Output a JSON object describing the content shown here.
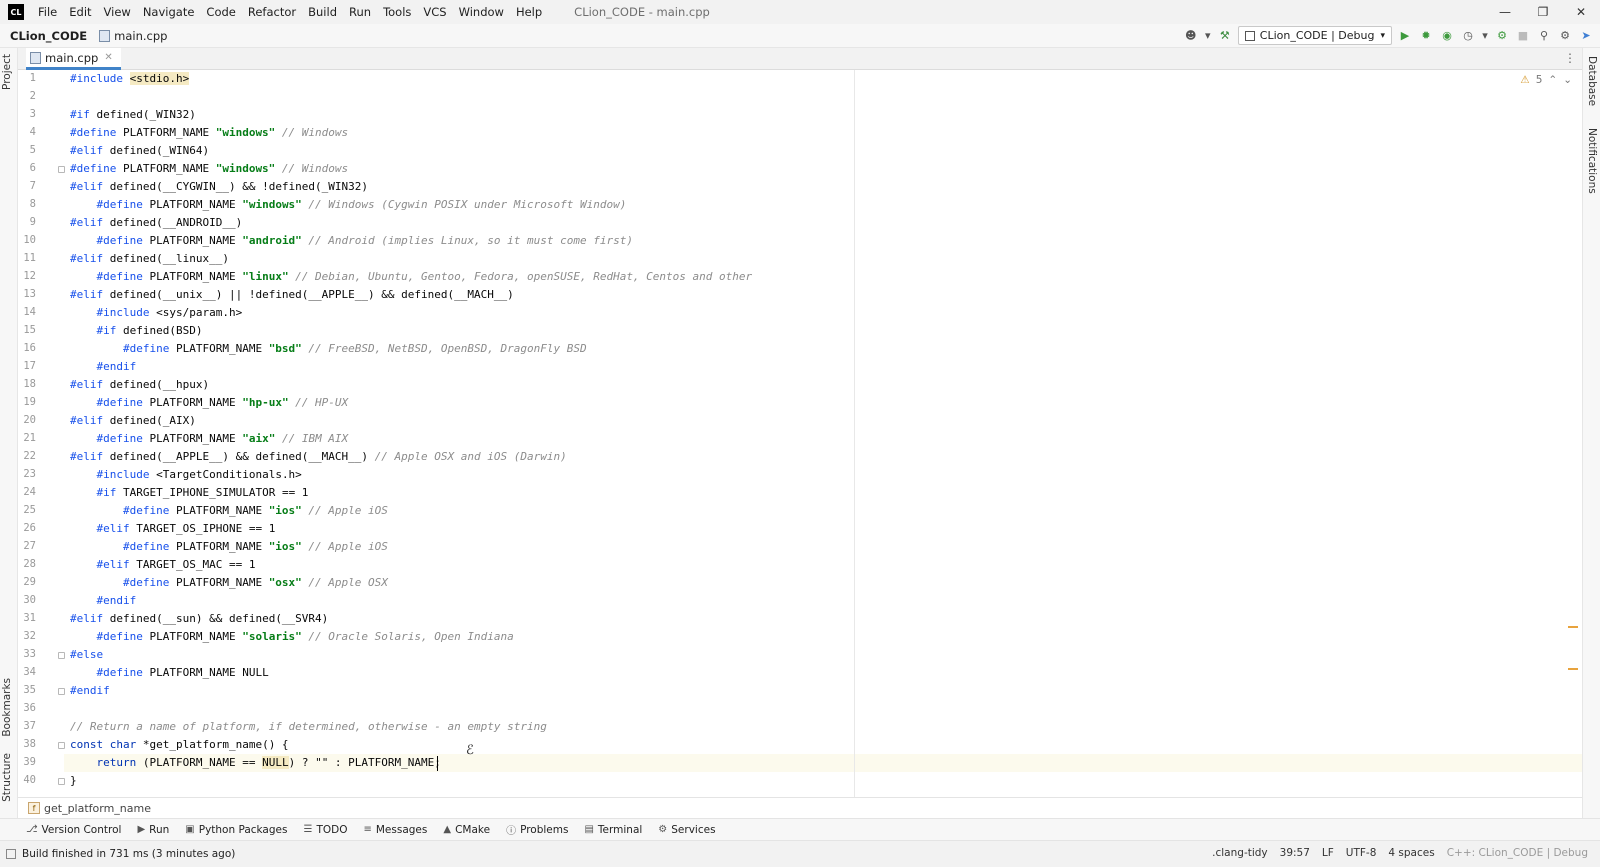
{
  "titlebar": {
    "logo": "CL",
    "menu": [
      "File",
      "Edit",
      "View",
      "Navigate",
      "Code",
      "Refactor",
      "Build",
      "Run",
      "Tools",
      "VCS",
      "Window",
      "Help"
    ],
    "window_title": "CLion_CODE - main.cpp"
  },
  "navbar": {
    "project": "CLion_CODE",
    "file": "main.cpp",
    "run_config": "CLion_CODE | Debug"
  },
  "side_tabs": {
    "project": "Project",
    "bookmarks": "Bookmarks",
    "structure": "Structure",
    "database": "Database",
    "notifications": "Notifications"
  },
  "editor_tab": {
    "label": "main.cpp"
  },
  "inspection": {
    "warnings": "5"
  },
  "code_lines": [
    [
      [
        "pp",
        "#include "
      ],
      [
        "hl",
        "<stdio.h>"
      ]
    ],
    [],
    [
      [
        "pp",
        "#if "
      ],
      [
        "",
        "defined(_WIN32)"
      ]
    ],
    [
      [
        "pp",
        "#define "
      ],
      [
        "",
        "PLATFORM_NAME "
      ],
      [
        "str",
        "\"windows\""
      ],
      [
        "cm",
        " // Windows"
      ]
    ],
    [
      [
        "pp",
        "#elif "
      ],
      [
        "",
        "defined(_WIN64)"
      ]
    ],
    [
      [
        "pp",
        "#define "
      ],
      [
        "",
        "PLATFORM_NAME "
      ],
      [
        "str",
        "\"windows\""
      ],
      [
        "cm",
        " // Windows"
      ]
    ],
    [
      [
        "pp",
        "#elif "
      ],
      [
        "",
        "defined(__CYGWIN__) && !defined(_WIN32)"
      ]
    ],
    [
      [
        "",
        "    "
      ],
      [
        "pp",
        "#define "
      ],
      [
        "",
        "PLATFORM_NAME "
      ],
      [
        "str",
        "\"windows\""
      ],
      [
        "cm",
        " // Windows (Cygwin POSIX under Microsoft Window)"
      ]
    ],
    [
      [
        "pp",
        "#elif "
      ],
      [
        "",
        "defined(__ANDROID__)"
      ]
    ],
    [
      [
        "",
        "    "
      ],
      [
        "pp",
        "#define "
      ],
      [
        "",
        "PLATFORM_NAME "
      ],
      [
        "str",
        "\"android\""
      ],
      [
        "cm",
        " // Android (implies Linux, so it must come first)"
      ]
    ],
    [
      [
        "pp",
        "#elif "
      ],
      [
        "",
        "defined(__linux__)"
      ]
    ],
    [
      [
        "",
        "    "
      ],
      [
        "pp",
        "#define "
      ],
      [
        "",
        "PLATFORM_NAME "
      ],
      [
        "str",
        "\"linux\""
      ],
      [
        "cm",
        " // Debian, Ubuntu, Gentoo, Fedora, openSUSE, RedHat, Centos and other"
      ]
    ],
    [
      [
        "pp",
        "#elif "
      ],
      [
        "",
        "defined(__unix__) || !defined(__APPLE__) && defined(__MACH__)"
      ]
    ],
    [
      [
        "",
        "    "
      ],
      [
        "pp",
        "#include "
      ],
      [
        "",
        "<sys/param.h>"
      ]
    ],
    [
      [
        "",
        "    "
      ],
      [
        "pp",
        "#if "
      ],
      [
        "",
        "defined(BSD)"
      ]
    ],
    [
      [
        "",
        "        "
      ],
      [
        "pp",
        "#define "
      ],
      [
        "",
        "PLATFORM_NAME "
      ],
      [
        "str",
        "\"bsd\""
      ],
      [
        "cm",
        " // FreeBSD, NetBSD, OpenBSD, DragonFly BSD"
      ]
    ],
    [
      [
        "",
        "    "
      ],
      [
        "pp",
        "#endif"
      ]
    ],
    [
      [
        "pp",
        "#elif "
      ],
      [
        "",
        "defined(__hpux)"
      ]
    ],
    [
      [
        "",
        "    "
      ],
      [
        "pp",
        "#define "
      ],
      [
        "",
        "PLATFORM_NAME "
      ],
      [
        "str",
        "\"hp-ux\""
      ],
      [
        "cm",
        " // HP-UX"
      ]
    ],
    [
      [
        "pp",
        "#elif "
      ],
      [
        "",
        "defined(_AIX)"
      ]
    ],
    [
      [
        "",
        "    "
      ],
      [
        "pp",
        "#define "
      ],
      [
        "",
        "PLATFORM_NAME "
      ],
      [
        "str",
        "\"aix\""
      ],
      [
        "cm",
        " // IBM AIX"
      ]
    ],
    [
      [
        "pp",
        "#elif "
      ],
      [
        "",
        "defined(__APPLE__) && defined(__MACH__)"
      ],
      [
        "cm",
        " // Apple OSX and iOS (Darwin)"
      ]
    ],
    [
      [
        "",
        "    "
      ],
      [
        "pp",
        "#include "
      ],
      [
        "",
        "<TargetConditionals.h>"
      ]
    ],
    [
      [
        "",
        "    "
      ],
      [
        "pp",
        "#if "
      ],
      [
        "",
        "TARGET_IPHONE_SIMULATOR == 1"
      ]
    ],
    [
      [
        "",
        "        "
      ],
      [
        "pp",
        "#define "
      ],
      [
        "",
        "PLATFORM_NAME "
      ],
      [
        "str",
        "\"ios\""
      ],
      [
        "cm",
        " // Apple iOS"
      ]
    ],
    [
      [
        "",
        "    "
      ],
      [
        "pp",
        "#elif "
      ],
      [
        "",
        "TARGET_OS_IPHONE == 1"
      ]
    ],
    [
      [
        "",
        "        "
      ],
      [
        "pp",
        "#define "
      ],
      [
        "",
        "PLATFORM_NAME "
      ],
      [
        "str",
        "\"ios\""
      ],
      [
        "cm",
        " // Apple iOS"
      ]
    ],
    [
      [
        "",
        "    "
      ],
      [
        "pp",
        "#elif "
      ],
      [
        "",
        "TARGET_OS_MAC == 1"
      ]
    ],
    [
      [
        "",
        "        "
      ],
      [
        "pp",
        "#define "
      ],
      [
        "",
        "PLATFORM_NAME "
      ],
      [
        "str",
        "\"osx\""
      ],
      [
        "cm",
        " // Apple OSX"
      ]
    ],
    [
      [
        "",
        "    "
      ],
      [
        "pp",
        "#endif"
      ]
    ],
    [
      [
        "pp",
        "#elif "
      ],
      [
        "",
        "defined(__sun) && defined(__SVR4)"
      ]
    ],
    [
      [
        "",
        "    "
      ],
      [
        "pp",
        "#define "
      ],
      [
        "",
        "PLATFORM_NAME "
      ],
      [
        "str",
        "\"solaris\""
      ],
      [
        "cm",
        " // Oracle Solaris, Open Indiana"
      ]
    ],
    [
      [
        "pp",
        "#else"
      ]
    ],
    [
      [
        "",
        "    "
      ],
      [
        "pp",
        "#define "
      ],
      [
        "",
        "PLATFORM_NAME NULL"
      ]
    ],
    [
      [
        "pp",
        "#endif"
      ]
    ],
    [],
    [
      [
        "cm",
        "// Return a name of platform, if determined, otherwise - an empty string"
      ]
    ],
    [
      [
        "kw",
        "const char "
      ],
      [
        "",
        "*get_platform_name() {"
      ]
    ],
    [
      [
        "",
        "    "
      ],
      [
        "kw",
        "return "
      ],
      [
        "",
        "(PLATFORM_NAME == "
      ],
      [
        "hl",
        "NULL"
      ],
      [
        "",
        ") ? \"\" : PLATFORM_NAME;"
      ]
    ],
    [
      [
        "",
        "}"
      ]
    ]
  ],
  "breadcrumb": {
    "function": "get_platform_name"
  },
  "tool_windows": [
    {
      "icon": "branch-icon",
      "label": "Version Control"
    },
    {
      "icon": "play-icon",
      "label": "Run"
    },
    {
      "icon": "package-icon",
      "label": "Python Packages"
    },
    {
      "icon": "list-icon",
      "label": "TODO"
    },
    {
      "icon": "messages-icon",
      "label": "Messages"
    },
    {
      "icon": "cmake-icon",
      "label": "CMake"
    },
    {
      "icon": "problems-icon",
      "label": "Problems"
    },
    {
      "icon": "terminal-icon",
      "label": "Terminal"
    },
    {
      "icon": "services-icon",
      "label": "Services"
    }
  ],
  "status": {
    "message": "Build finished in 731 ms (3 minutes ago)",
    "linter": ".clang-tidy",
    "position": "39:57",
    "line_ending": "LF",
    "encoding": "UTF-8",
    "indent": "4 spaces",
    "context": "C++: CLion_CODE | Debug"
  },
  "colors": {
    "accent": "#4083c9",
    "preprocessor": "#1750eb",
    "keyword": "#0033b3",
    "string": "#067d17",
    "comment": "#8c8c8c",
    "warning": "#d69a2f"
  }
}
